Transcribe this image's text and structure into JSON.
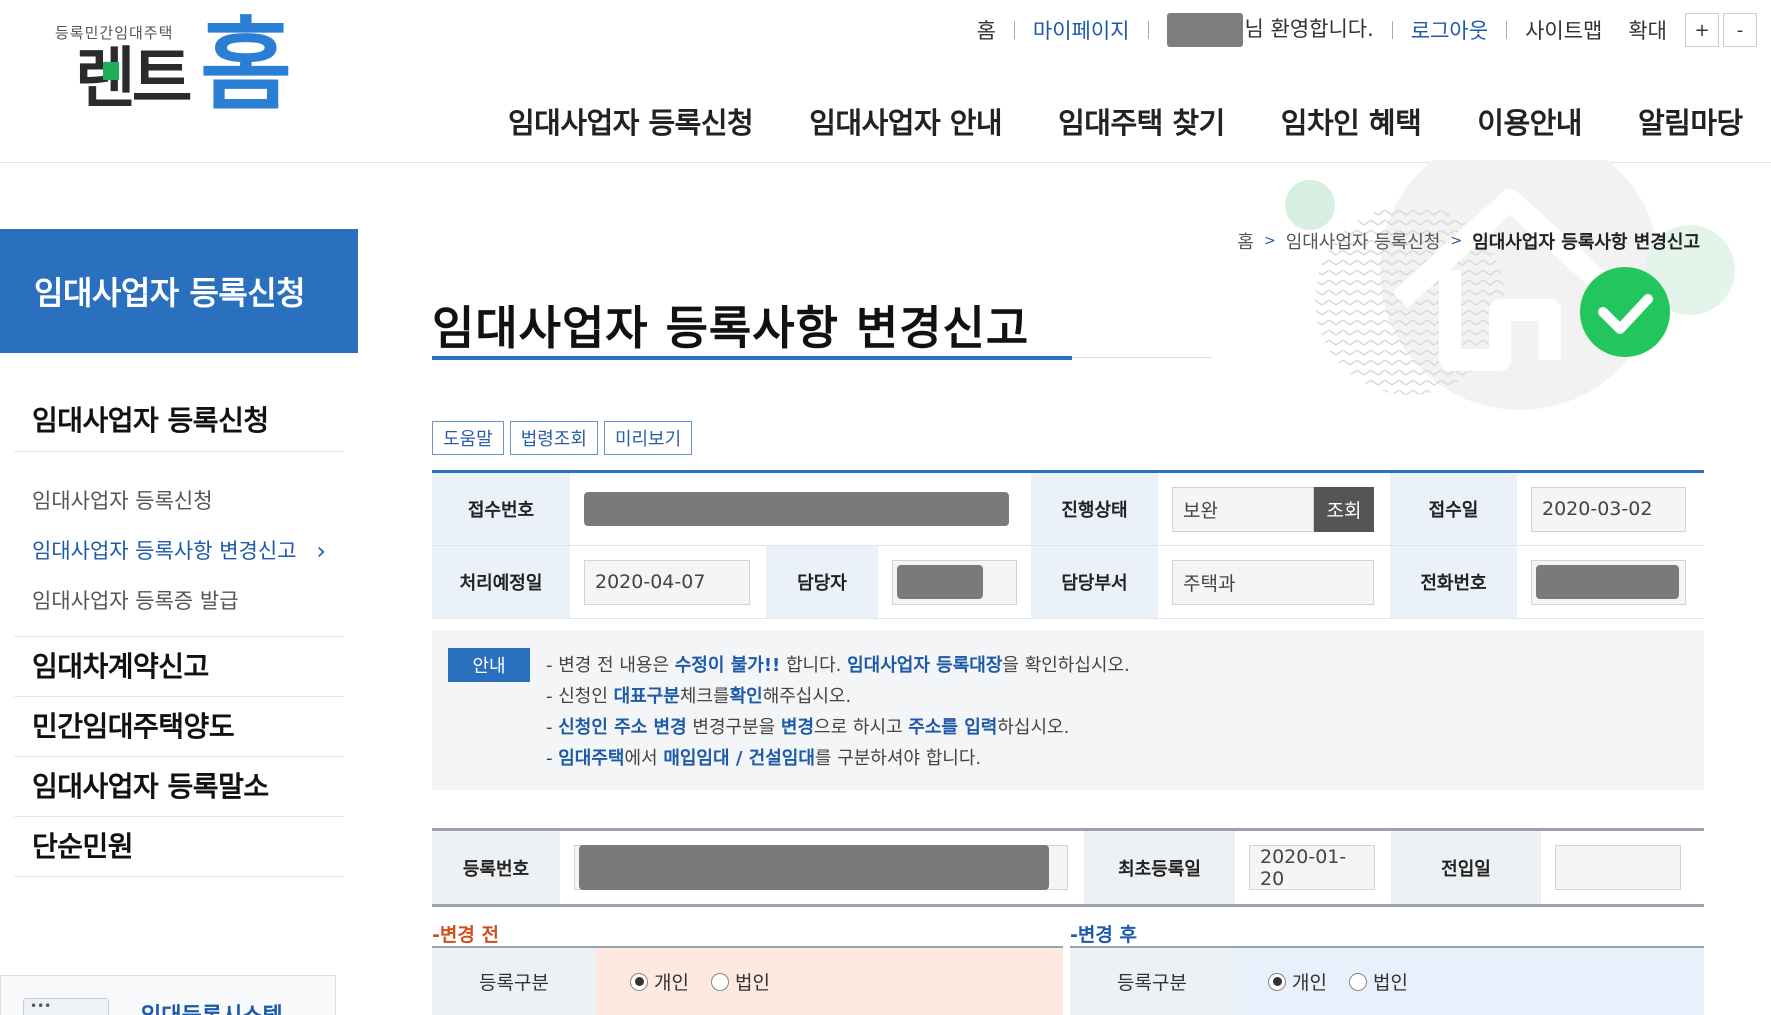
{
  "brand": {
    "tagline": "등록민간임대주택",
    "name_left": "렌트",
    "name_right": "홈"
  },
  "util": {
    "home": "홈",
    "mypage": "마이페이지",
    "welcome": "님 환영합니다.",
    "logout": "로그아웃",
    "sitemap": "사이트맵",
    "zoom": "확대",
    "zoom_in": "+",
    "zoom_out": "-"
  },
  "gnb": [
    "임대사업자 등록신청",
    "임대사업자 안내",
    "임대주택 찾기",
    "임차인 혜택",
    "이용안내",
    "알림마당"
  ],
  "lnb": {
    "title": "임대사업자 등록신청",
    "category1": "임대사업자 등록신청",
    "subitems": [
      "임대사업자 등록신청",
      "임대사업자 등록사항 변경신고",
      "임대사업자 등록증 발급"
    ],
    "active_chevron": "›",
    "categories": [
      "임대차계약신고",
      "민간임대주택양도",
      "임대사업자 등록말소",
      "단순민원"
    ]
  },
  "banner": {
    "text": "임대등록시스템",
    "icon_text": "•••"
  },
  "breadcrumb": {
    "home": "홈",
    "sep": ">",
    "level1": "임대사업자 등록신청",
    "current": "임대사업자 등록사항 변경신고"
  },
  "page": {
    "title": "임대사업자 등록사항 변경신고"
  },
  "tools": [
    "도움말",
    "법령조회",
    "미리보기"
  ],
  "form": {
    "receipt_no_label": "접수번호",
    "status_label": "진행상태",
    "status_value": "보완",
    "status_btn": "조회",
    "receipt_date_label": "접수일",
    "receipt_date": "2020-03-02",
    "due_date_label": "처리예정일",
    "due_date": "2020-04-07",
    "manager_label": "담당자",
    "dept_label": "담당부서",
    "dept_value": "주택과",
    "phone_label": "전화번호"
  },
  "notice": {
    "badge": "안내",
    "line1": [
      "- 변경 전 내용은 ",
      "수정이 불가!!",
      " 합니다. ",
      "임대사업자 등록대장",
      "을 확인하십시오."
    ],
    "line2": [
      "- 신청인 ",
      "대표구분",
      "체크를",
      "확인",
      "해주십시오."
    ],
    "line3": [
      "- ",
      "신청인 주소 변경",
      " 변경구분을 ",
      "변경",
      "으로 하시고 ",
      "주소를 입력",
      "하십시오."
    ],
    "line4": [
      "- ",
      "임대주택",
      "에서 ",
      "매입임대 / 건설임대",
      "를 구분하셔야 합니다."
    ]
  },
  "registration": {
    "reg_no_label": "등록번호",
    "first_reg_label": "최초등록일",
    "first_reg_date": "2020-01-20",
    "movein_label": "전입일",
    "movein_value": ""
  },
  "before": {
    "label": "-변경 전",
    "type_label": "등록구분",
    "opt_individual": "개인",
    "opt_corp": "법인"
  },
  "after": {
    "label": "-변경 후",
    "type_label": "등록구분",
    "opt_individual": "개인",
    "opt_corp": "법인"
  },
  "colors": {
    "primary": "#2b6fbf",
    "link": "#1d5aa8",
    "before_bg": "#fde9df",
    "after_bg": "#e7f0fb",
    "check_green": "#22c55e"
  }
}
